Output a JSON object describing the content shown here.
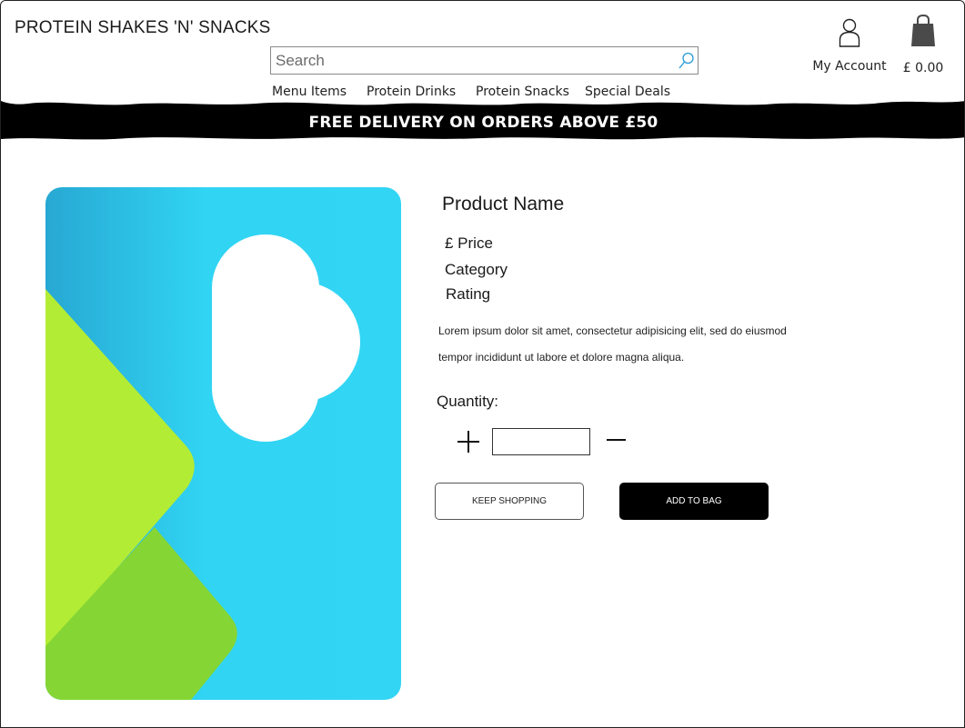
{
  "header": {
    "store_name": "PROTEIN SHAKES 'N' SNACKS",
    "search": {
      "placeholder": "Search",
      "value": ""
    },
    "nav": [
      "Menu Items",
      "Protein Drinks",
      "Protein Snacks",
      "Special Deals"
    ],
    "account_label": "My Account",
    "cart_total": "£ 0.00",
    "icons": {
      "search": "search-icon",
      "account": "user-icon",
      "cart": "shopping-bag-icon"
    }
  },
  "banner": {
    "text": "FREE DELIVERY ON ORDERS ABOVE £50",
    "background": "#000000",
    "color": "#ffffff"
  },
  "product": {
    "name": "Product Name",
    "price": "£ Price",
    "category": "Category",
    "rating": "Rating",
    "description_line1": "Lorem ipsum dolor sit amet, consectetur adipisicing elit, sed do eiusmod",
    "description_line2": "tempor incididunt ut labore et dolore magna aliqua.",
    "image": "placeholder-image",
    "image_colors": {
      "sky": "#31d4f3",
      "light_green": "#b3ec35",
      "dark_green": "#85d634",
      "cloud": "#ffffff"
    }
  },
  "quantity": {
    "label": "Quantity:",
    "value": "",
    "plus_icon": "plus-icon",
    "minus_icon": "minus-icon"
  },
  "actions": {
    "keep_shopping": "KEEP SHOPPING",
    "add_to_bag": "ADD TO BAG"
  }
}
